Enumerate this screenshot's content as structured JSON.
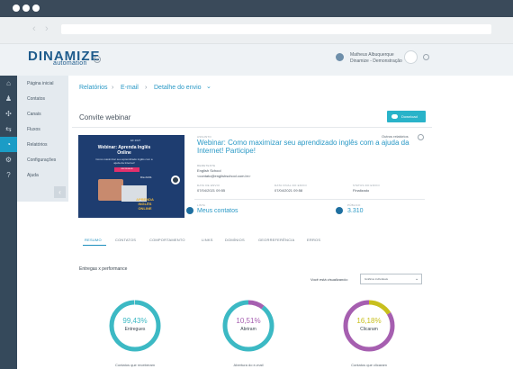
{
  "brand": {
    "logo_main": "DINAMIZE",
    "logo_sub": "automation"
  },
  "user": {
    "name": "Matheus Albuquerque",
    "role": "Dinamize - Demonstração"
  },
  "sidebar": {
    "items": [
      {
        "label": "Página inicial",
        "icon": "home-icon",
        "glyph": "⌂"
      },
      {
        "label": "Contatos",
        "icon": "users-icon",
        "glyph": "♟"
      },
      {
        "label": "Canais",
        "icon": "channels-icon",
        "glyph": "✣"
      },
      {
        "label": "Fluxos",
        "icon": "flows-icon",
        "glyph": "⇆"
      },
      {
        "label": "Relatórios",
        "icon": "pie-chart-icon",
        "glyph": "◔"
      },
      {
        "label": "Configurações",
        "icon": "gear-icon",
        "glyph": "⚙"
      },
      {
        "label": "Ajuda",
        "icon": "help-icon",
        "glyph": "?"
      }
    ],
    "active_index": 4,
    "collapse_glyph": "‹"
  },
  "breadcrumb": {
    "items": [
      "Relatórios",
      "E-mail",
      "Detalhe do envio"
    ],
    "separator": "›",
    "caret": "⌄"
  },
  "card": {
    "title": "Convite webinar",
    "download_label": "Download",
    "outros_label": "Outros relatórios"
  },
  "thumbnail": {
    "tag": "EF 2027",
    "title": "Webinar: Aprenda Inglês Online",
    "text": "Como maximizar seu aprendizado inglês com a ajuda da Internet!",
    "button": "INSCREVA-SE",
    "date": "Dia 24/11",
    "promo": "APRENDA INGLÊS ONLINE"
  },
  "details": {
    "assunto_label": "ASSUNTO",
    "assunto": "Webinar: Como maximizar seu aprendizado inglês com a ajuda da Internet! Participe!",
    "remetente_label": "REMETENTE",
    "remetente_name": "English School",
    "remetente_email": "<contato@englishschool.com.br>",
    "data_envio_label": "DATA DE ENVIO",
    "data_envio": "07/04/2021 09:55",
    "data_final_label": "DATA FINAL DO ENVIO",
    "data_final": "07/04/2021 09:58",
    "status_label": "STATUS DO ENVIO",
    "status": "Finalizado",
    "lista_label": "LISTA",
    "lista": "Meus contatos",
    "publico_label": "PÚBLICO",
    "publico": "3.310"
  },
  "tabs": [
    "RESUMO",
    "CONTATOS",
    "COMPORTAMENTO",
    "LINKS",
    "DOMÍNIOS",
    "GEORREFERÊNCIA",
    "ERROS"
  ],
  "performance": {
    "title": "Entregas x performance",
    "viz_label": "Você está visualizando:",
    "viz_value": "Gráficos individuais",
    "viz_caret": "⌄"
  },
  "colors": {
    "teal": "#3cb9c4",
    "purple": "#a65fb0",
    "olive": "#c8bf1e",
    "track": "#e6e9ec"
  },
  "chart_data": [
    {
      "type": "pie",
      "value_text": "99,43%",
      "label": "Entregues",
      "caption": "Contatos que receberam",
      "values": [
        99.43,
        0.57
      ],
      "colors": [
        "#3cb9c4",
        "#e6e9ec"
      ]
    },
    {
      "type": "pie",
      "value_text": "10,51%",
      "label": "Abriram",
      "caption": "Abertura do e-mail",
      "values": [
        10.51,
        89.49
      ],
      "colors": [
        "#a65fb0",
        "#3cb9c4"
      ]
    },
    {
      "type": "pie",
      "value_text": "16,18%",
      "label": "Clicaram",
      "caption": "Contatos que clicaram",
      "values": [
        16.18,
        83.82
      ],
      "colors": [
        "#c8bf1e",
        "#a65fb0"
      ]
    }
  ]
}
